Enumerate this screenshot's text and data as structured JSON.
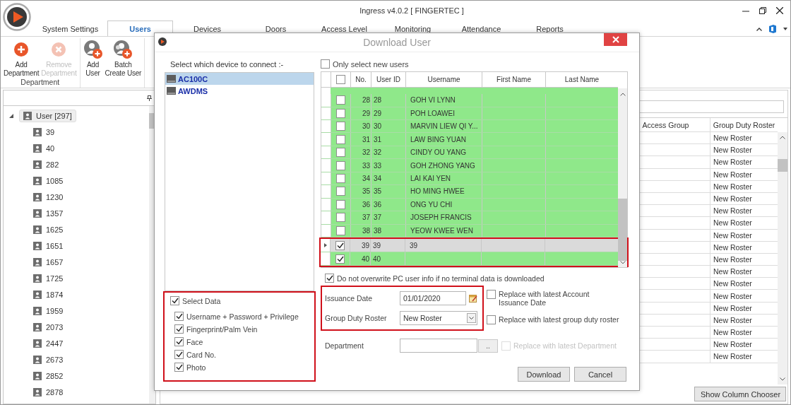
{
  "window": {
    "title": "Ingress v4.0.2 [ FINGERTEC ]"
  },
  "tabs": [
    {
      "label": "System Settings",
      "selected": false
    },
    {
      "label": "Users",
      "selected": true
    },
    {
      "label": "Devices",
      "selected": false
    },
    {
      "label": "Doors",
      "selected": false
    },
    {
      "label": "Access Level",
      "selected": false
    },
    {
      "label": "Monitoring",
      "selected": false
    },
    {
      "label": "Attendance",
      "selected": false
    },
    {
      "label": "Reports",
      "selected": false
    }
  ],
  "ribbon": {
    "groups": [
      {
        "label": "Department",
        "buttons": [
          {
            "kind": "add",
            "lines": [
              "Add",
              "Department"
            ],
            "disabled": false
          },
          {
            "kind": "remove",
            "lines": [
              "Remove",
              "Department"
            ],
            "disabled": true
          }
        ]
      },
      {
        "buttons": [
          {
            "kind": "add-user",
            "lines": [
              "Add",
              "User"
            ],
            "disabled": false
          },
          {
            "kind": "batch",
            "lines": [
              "Batch",
              "Create User"
            ],
            "disabled": false
          }
        ]
      }
    ]
  },
  "tree": {
    "label": "User [297]",
    "expanded": true,
    "selected": true,
    "children": [
      {
        "label": "39"
      },
      {
        "label": "40"
      },
      {
        "label": "282"
      },
      {
        "label": "1085"
      },
      {
        "label": "1230"
      },
      {
        "label": "1357"
      },
      {
        "label": "1625"
      },
      {
        "label": "1651"
      },
      {
        "label": "1657"
      },
      {
        "label": "1725"
      },
      {
        "label": "1874"
      },
      {
        "label": "1959"
      },
      {
        "label": "2073"
      },
      {
        "label": "2447"
      },
      {
        "label": "2673"
      },
      {
        "label": "2852"
      },
      {
        "label": "2878"
      }
    ]
  },
  "user_grid": {
    "columns": [
      "Access Group",
      "Group Duty Roster"
    ],
    "rows": [
      "New Roster",
      "New Roster",
      "New Roster",
      "New Roster",
      "New Roster",
      "New Roster",
      "New Roster",
      "New Roster",
      "New Roster",
      "New Roster",
      "New Roster",
      "New Roster",
      "New Roster",
      "New Roster",
      "New Roster",
      "New Roster",
      "New Roster",
      "New Roster",
      "New Roster"
    ]
  },
  "show_column_chooser": "Show Column Chooser",
  "dialog": {
    "title": "Download User",
    "device_prompt": "Select which device to connect :-",
    "devices": [
      {
        "name": "AC100C",
        "selected": true
      },
      {
        "name": "AWDMS",
        "selected": false
      }
    ],
    "select_data": {
      "label": "Select Data",
      "checked": true,
      "highlighted": true,
      "options": [
        {
          "label": "Username + Password + Privilege",
          "checked": true
        },
        {
          "label": "Fingerprint/Palm Vein",
          "checked": true
        },
        {
          "label": "Face",
          "checked": true
        },
        {
          "label": "Card No.",
          "checked": true
        },
        {
          "label": "Photo",
          "checked": true
        }
      ]
    },
    "only_new_users": {
      "label": "Only select new users",
      "checked": false
    },
    "grid": {
      "header_checked": false,
      "columns": [
        "No.",
        "User ID",
        "Username",
        "First Name",
        "Last Name"
      ],
      "rows": [
        {
          "no": "28",
          "user_id": "28",
          "username": "GOH VI LYNN",
          "checked": false,
          "selected": false,
          "highlighted": false
        },
        {
          "no": "29",
          "user_id": "29",
          "username": "POH LOAWEI",
          "checked": false,
          "selected": false,
          "highlighted": false
        },
        {
          "no": "30",
          "user_id": "30",
          "username": "MARVIN LIEW QI Y...",
          "checked": false,
          "selected": false,
          "highlighted": false
        },
        {
          "no": "31",
          "user_id": "31",
          "username": "LAW BING YUAN",
          "checked": false,
          "selected": false,
          "highlighted": false
        },
        {
          "no": "32",
          "user_id": "32",
          "username": "CINDY OU YANG",
          "checked": false,
          "selected": false,
          "highlighted": false
        },
        {
          "no": "33",
          "user_id": "33",
          "username": "GOH ZHONG YANG",
          "checked": false,
          "selected": false,
          "highlighted": false
        },
        {
          "no": "34",
          "user_id": "34",
          "username": "LAI KAI YEN",
          "checked": false,
          "selected": false,
          "highlighted": false
        },
        {
          "no": "35",
          "user_id": "35",
          "username": "HO MING HWEE",
          "checked": false,
          "selected": false,
          "highlighted": false
        },
        {
          "no": "36",
          "user_id": "36",
          "username": "ONG YU CHI",
          "checked": false,
          "selected": false,
          "highlighted": false
        },
        {
          "no": "37",
          "user_id": "37",
          "username": "JOSEPH FRANCIS",
          "checked": false,
          "selected": false,
          "highlighted": false
        },
        {
          "no": "38",
          "user_id": "38",
          "username": "YEOW KWEE WEN",
          "checked": false,
          "selected": false,
          "highlighted": false
        },
        {
          "no": "39",
          "user_id": "39",
          "username": "39",
          "checked": true,
          "selected": true,
          "highlighted": true
        },
        {
          "no": "40",
          "user_id": "40",
          "checked": true,
          "selected": false,
          "highlighted": true
        }
      ]
    },
    "keep_pc_info": {
      "label": "Do not overwrite PC user info if no terminal data is downloaded",
      "checked": true
    },
    "fields_highlighted": true,
    "issuance_date": {
      "label": "Issuance Date",
      "value": "01/01/2020",
      "replace_label": "Replace with latest Account Issuance Date",
      "replace_checked": false
    },
    "group_duty_roster": {
      "label": "Group Duty Roster",
      "value": "New Roster",
      "replace_label": "Replace with latest group duty roster",
      "replace_checked": false
    },
    "department": {
      "label": "Department",
      "browse": "..",
      "replace_label": "Replace with latest Department",
      "replace_checked": false,
      "replace_disabled": true
    },
    "buttons": [
      "Download",
      "Cancel"
    ]
  }
}
